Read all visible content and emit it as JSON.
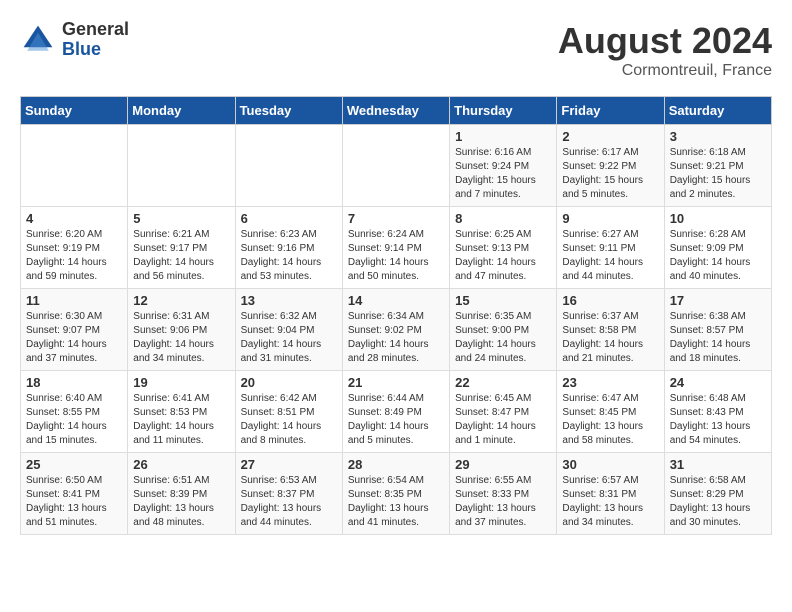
{
  "header": {
    "logo_general": "General",
    "logo_blue": "Blue",
    "month": "August 2024",
    "location": "Cormontreuil, France"
  },
  "weekdays": [
    "Sunday",
    "Monday",
    "Tuesday",
    "Wednesday",
    "Thursday",
    "Friday",
    "Saturday"
  ],
  "weeks": [
    [
      {
        "day": "",
        "info": ""
      },
      {
        "day": "",
        "info": ""
      },
      {
        "day": "",
        "info": ""
      },
      {
        "day": "",
        "info": ""
      },
      {
        "day": "1",
        "info": "Sunrise: 6:16 AM\nSunset: 9:24 PM\nDaylight: 15 hours\nand 7 minutes."
      },
      {
        "day": "2",
        "info": "Sunrise: 6:17 AM\nSunset: 9:22 PM\nDaylight: 15 hours\nand 5 minutes."
      },
      {
        "day": "3",
        "info": "Sunrise: 6:18 AM\nSunset: 9:21 PM\nDaylight: 15 hours\nand 2 minutes."
      }
    ],
    [
      {
        "day": "4",
        "info": "Sunrise: 6:20 AM\nSunset: 9:19 PM\nDaylight: 14 hours\nand 59 minutes."
      },
      {
        "day": "5",
        "info": "Sunrise: 6:21 AM\nSunset: 9:17 PM\nDaylight: 14 hours\nand 56 minutes."
      },
      {
        "day": "6",
        "info": "Sunrise: 6:23 AM\nSunset: 9:16 PM\nDaylight: 14 hours\nand 53 minutes."
      },
      {
        "day": "7",
        "info": "Sunrise: 6:24 AM\nSunset: 9:14 PM\nDaylight: 14 hours\nand 50 minutes."
      },
      {
        "day": "8",
        "info": "Sunrise: 6:25 AM\nSunset: 9:13 PM\nDaylight: 14 hours\nand 47 minutes."
      },
      {
        "day": "9",
        "info": "Sunrise: 6:27 AM\nSunset: 9:11 PM\nDaylight: 14 hours\nand 44 minutes."
      },
      {
        "day": "10",
        "info": "Sunrise: 6:28 AM\nSunset: 9:09 PM\nDaylight: 14 hours\nand 40 minutes."
      }
    ],
    [
      {
        "day": "11",
        "info": "Sunrise: 6:30 AM\nSunset: 9:07 PM\nDaylight: 14 hours\nand 37 minutes."
      },
      {
        "day": "12",
        "info": "Sunrise: 6:31 AM\nSunset: 9:06 PM\nDaylight: 14 hours\nand 34 minutes."
      },
      {
        "day": "13",
        "info": "Sunrise: 6:32 AM\nSunset: 9:04 PM\nDaylight: 14 hours\nand 31 minutes."
      },
      {
        "day": "14",
        "info": "Sunrise: 6:34 AM\nSunset: 9:02 PM\nDaylight: 14 hours\nand 28 minutes."
      },
      {
        "day": "15",
        "info": "Sunrise: 6:35 AM\nSunset: 9:00 PM\nDaylight: 14 hours\nand 24 minutes."
      },
      {
        "day": "16",
        "info": "Sunrise: 6:37 AM\nSunset: 8:58 PM\nDaylight: 14 hours\nand 21 minutes."
      },
      {
        "day": "17",
        "info": "Sunrise: 6:38 AM\nSunset: 8:57 PM\nDaylight: 14 hours\nand 18 minutes."
      }
    ],
    [
      {
        "day": "18",
        "info": "Sunrise: 6:40 AM\nSunset: 8:55 PM\nDaylight: 14 hours\nand 15 minutes."
      },
      {
        "day": "19",
        "info": "Sunrise: 6:41 AM\nSunset: 8:53 PM\nDaylight: 14 hours\nand 11 minutes."
      },
      {
        "day": "20",
        "info": "Sunrise: 6:42 AM\nSunset: 8:51 PM\nDaylight: 14 hours\nand 8 minutes."
      },
      {
        "day": "21",
        "info": "Sunrise: 6:44 AM\nSunset: 8:49 PM\nDaylight: 14 hours\nand 5 minutes."
      },
      {
        "day": "22",
        "info": "Sunrise: 6:45 AM\nSunset: 8:47 PM\nDaylight: 14 hours\nand 1 minute."
      },
      {
        "day": "23",
        "info": "Sunrise: 6:47 AM\nSunset: 8:45 PM\nDaylight: 13 hours\nand 58 minutes."
      },
      {
        "day": "24",
        "info": "Sunrise: 6:48 AM\nSunset: 8:43 PM\nDaylight: 13 hours\nand 54 minutes."
      }
    ],
    [
      {
        "day": "25",
        "info": "Sunrise: 6:50 AM\nSunset: 8:41 PM\nDaylight: 13 hours\nand 51 minutes."
      },
      {
        "day": "26",
        "info": "Sunrise: 6:51 AM\nSunset: 8:39 PM\nDaylight: 13 hours\nand 48 minutes."
      },
      {
        "day": "27",
        "info": "Sunrise: 6:53 AM\nSunset: 8:37 PM\nDaylight: 13 hours\nand 44 minutes."
      },
      {
        "day": "28",
        "info": "Sunrise: 6:54 AM\nSunset: 8:35 PM\nDaylight: 13 hours\nand 41 minutes."
      },
      {
        "day": "29",
        "info": "Sunrise: 6:55 AM\nSunset: 8:33 PM\nDaylight: 13 hours\nand 37 minutes."
      },
      {
        "day": "30",
        "info": "Sunrise: 6:57 AM\nSunset: 8:31 PM\nDaylight: 13 hours\nand 34 minutes."
      },
      {
        "day": "31",
        "info": "Sunrise: 6:58 AM\nSunset: 8:29 PM\nDaylight: 13 hours\nand 30 minutes."
      }
    ]
  ]
}
